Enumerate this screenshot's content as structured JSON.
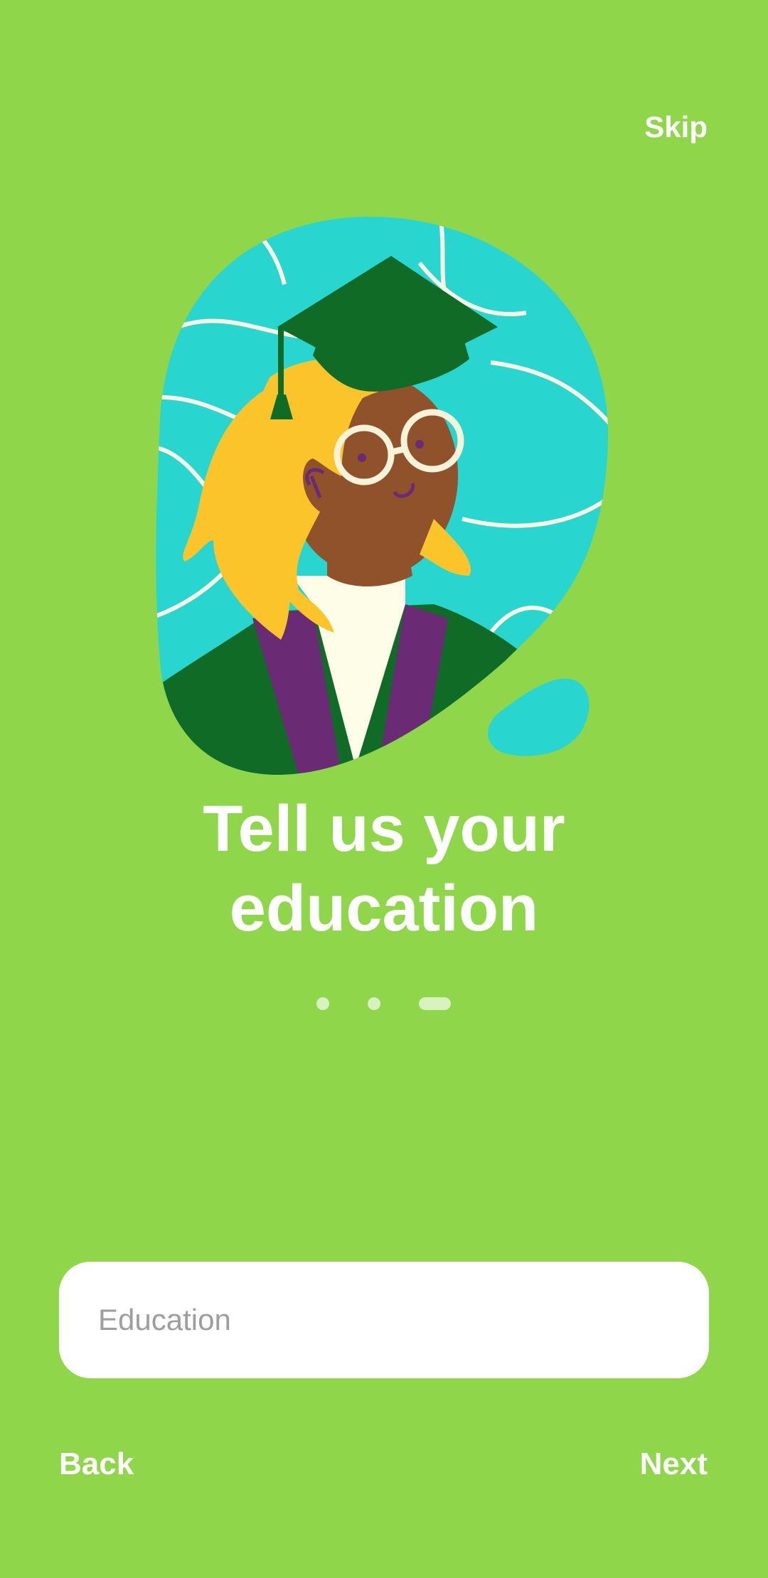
{
  "header": {
    "skip_label": "Skip"
  },
  "onboarding": {
    "title_line1": "Tell us your",
    "title_line2": "education",
    "pages_total": 3,
    "current_page": 3
  },
  "form": {
    "education_placeholder": "Education",
    "education_value": ""
  },
  "footer": {
    "back_label": "Back",
    "next_label": "Next"
  },
  "colors": {
    "background": "#8fd64a",
    "text": "#ffffff",
    "indicator": "#d7f1bf",
    "blob": "#29d6cf",
    "cap": "#0f6b25",
    "hair": "#fbc42b",
    "robe_trim": "#6a2a74"
  },
  "illustration": {
    "icon": "graduate-illustration"
  }
}
